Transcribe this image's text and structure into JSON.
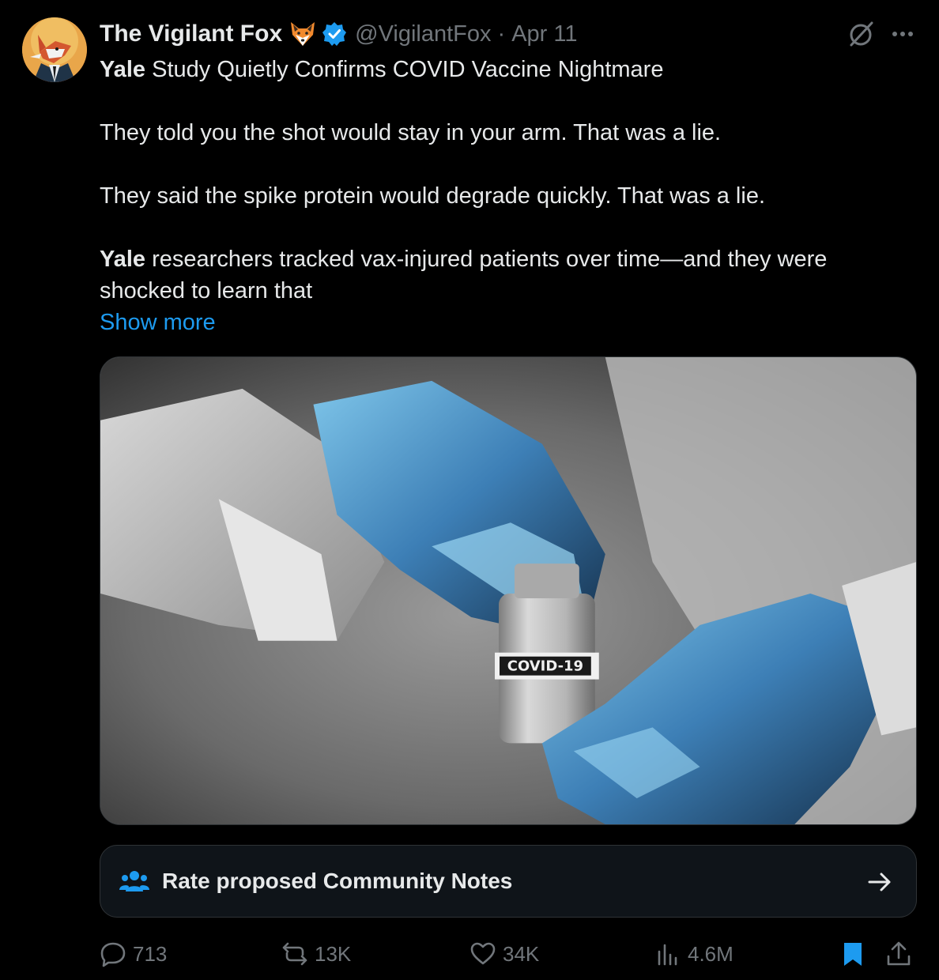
{
  "author": {
    "display_name": "The Vigilant Fox",
    "emoji": "fox-face-emoji",
    "verified": true,
    "handle": "@VigilantFox",
    "separator": "·",
    "date": "Apr 11"
  },
  "tweet": {
    "line1_bold": "Yale",
    "line1_rest": " Study Quietly Confirms COVID Vaccine Nightmare",
    "line2": "They told you the shot would stay in your arm. That was a lie.",
    "line3": "They said the spike protein would degrade quickly. That was a lie.",
    "line4_bold": "Yale",
    "line4_rest": " researchers tracked vax-injured patients over time—and they were shocked to learn that",
    "show_more": "Show more"
  },
  "media": {
    "vial_label": "COVID-19"
  },
  "community_notes": {
    "label": "Rate proposed Community Notes"
  },
  "actions": {
    "replies": "713",
    "reposts": "13K",
    "likes": "34K",
    "views": "4.6M"
  },
  "colors": {
    "background": "#000000",
    "text": "#e7e9ea",
    "muted": "#71767b",
    "accent": "#1d9bf0",
    "border": "#2f3336"
  }
}
